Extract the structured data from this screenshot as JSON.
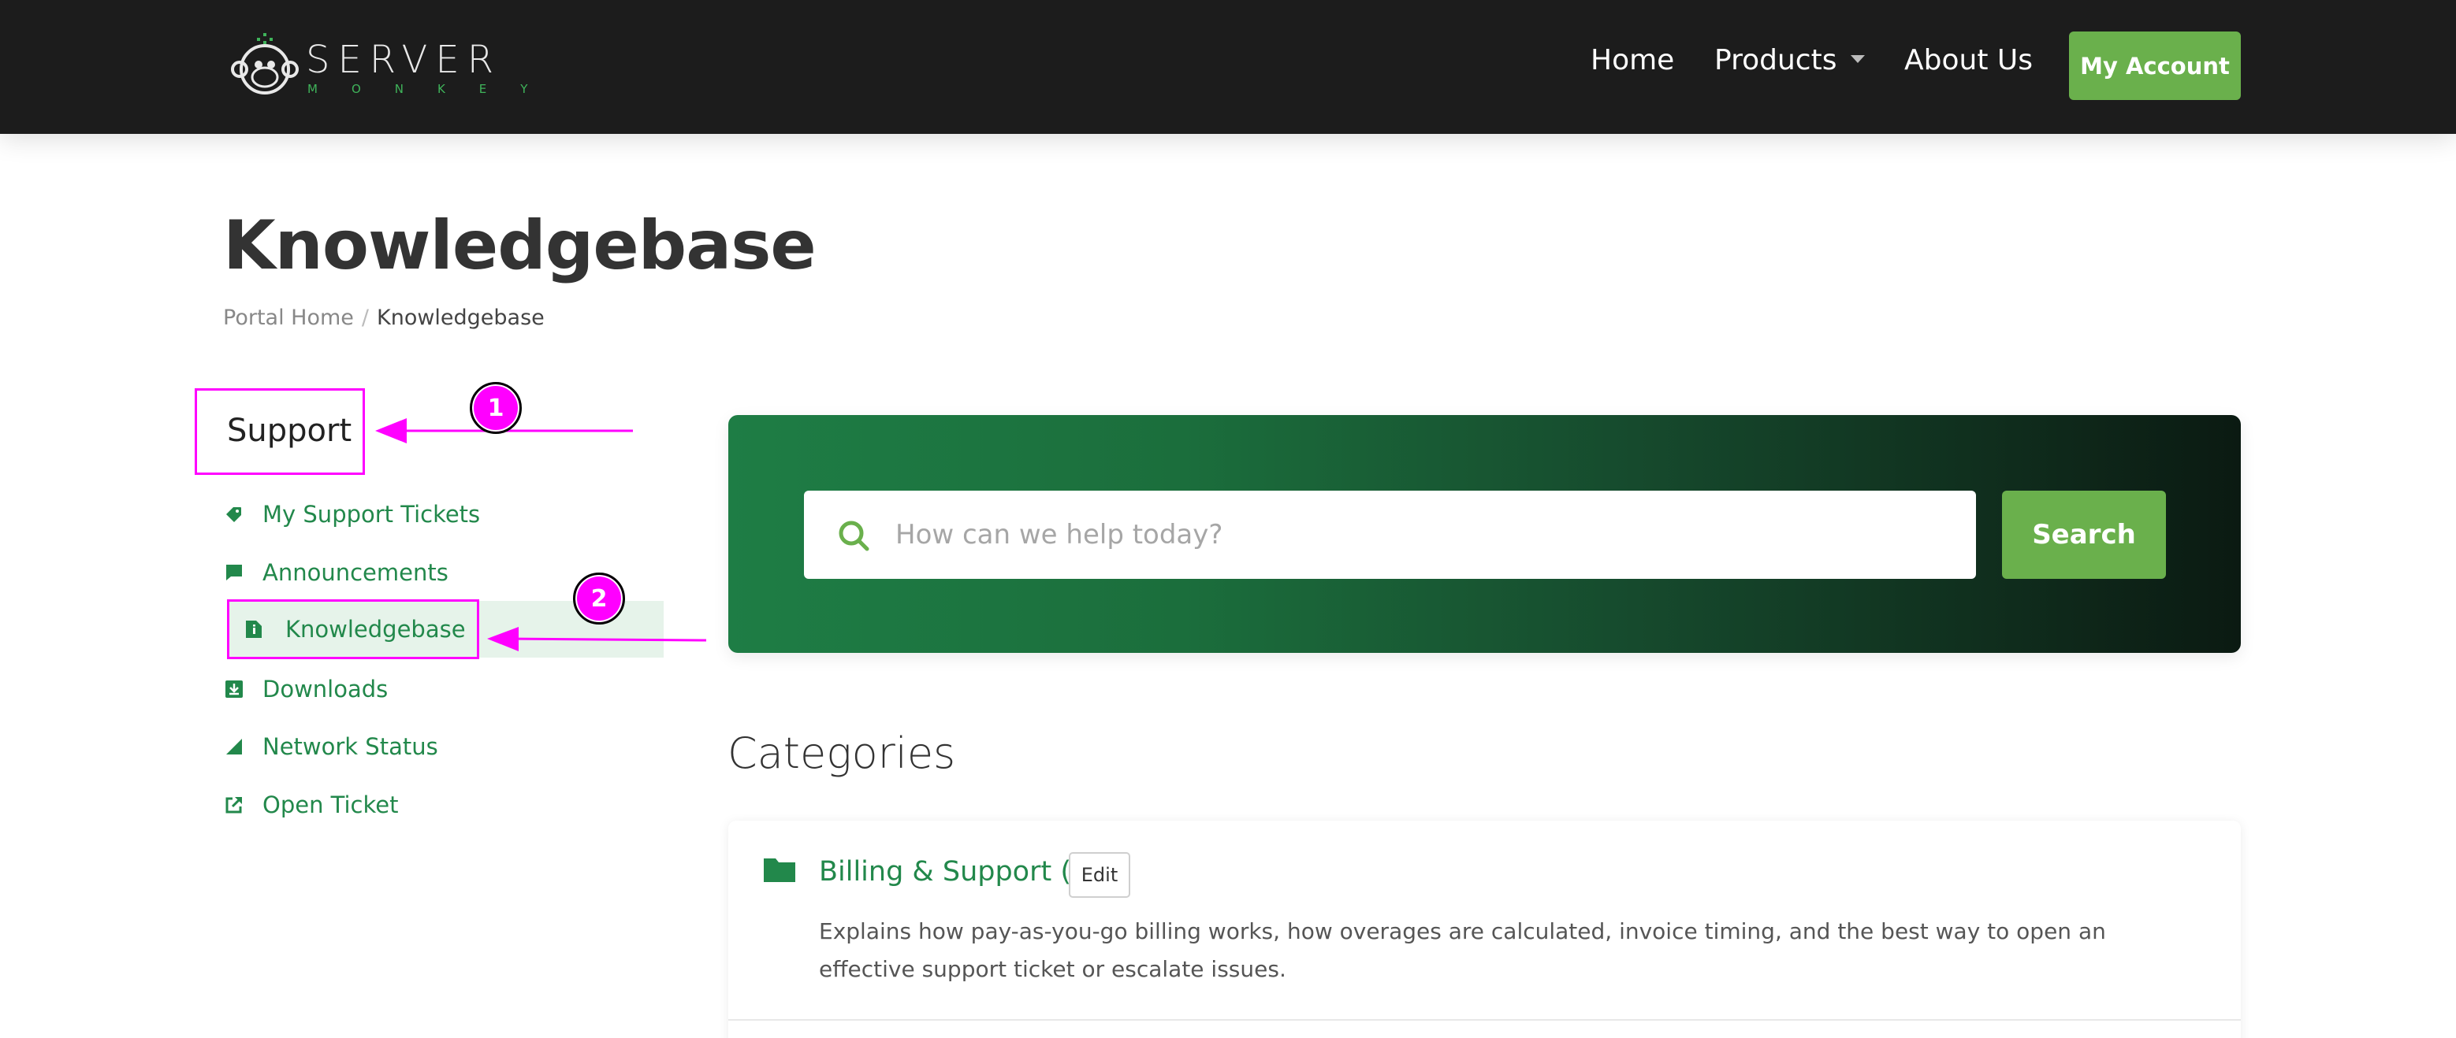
{
  "header": {
    "logo_text": "SERVER",
    "logo_subtext": "MONKEY",
    "nav": {
      "home": "Home",
      "products": "Products",
      "about": "About Us"
    },
    "account_button": "My Account"
  },
  "page": {
    "title": "Knowledgebase",
    "breadcrumb": {
      "home": "Portal Home",
      "separator": "/",
      "current": "Knowledgebase"
    }
  },
  "sidebar": {
    "title": "Support",
    "items": [
      {
        "label": "My Support Tickets",
        "icon": "ticket-icon"
      },
      {
        "label": "Announcements",
        "icon": "comment-icon"
      },
      {
        "label": "Knowledgebase",
        "icon": "document-info-icon",
        "active": true
      },
      {
        "label": "Downloads",
        "icon": "download-icon"
      },
      {
        "label": "Network Status",
        "icon": "signal-icon"
      },
      {
        "label": "Open Ticket",
        "icon": "external-link-icon"
      }
    ]
  },
  "search": {
    "placeholder": "How can we help today?",
    "button": "Search"
  },
  "categories": {
    "title": "Categories",
    "items": [
      {
        "name": "Billing & Support (1)",
        "edit_label": "Edit",
        "description": "Explains how pay-as-you-go billing works, how overages are calculated, invoice timing, and the best way to open an effective support ticket or escalate issues."
      }
    ]
  },
  "annotations": {
    "marker_1": "1",
    "marker_2": "2"
  },
  "colors": {
    "accent_green": "#6ab04c",
    "link_green": "#22884b",
    "header_bg": "#1c1c1c",
    "annotation_magenta": "#ff00ff"
  }
}
